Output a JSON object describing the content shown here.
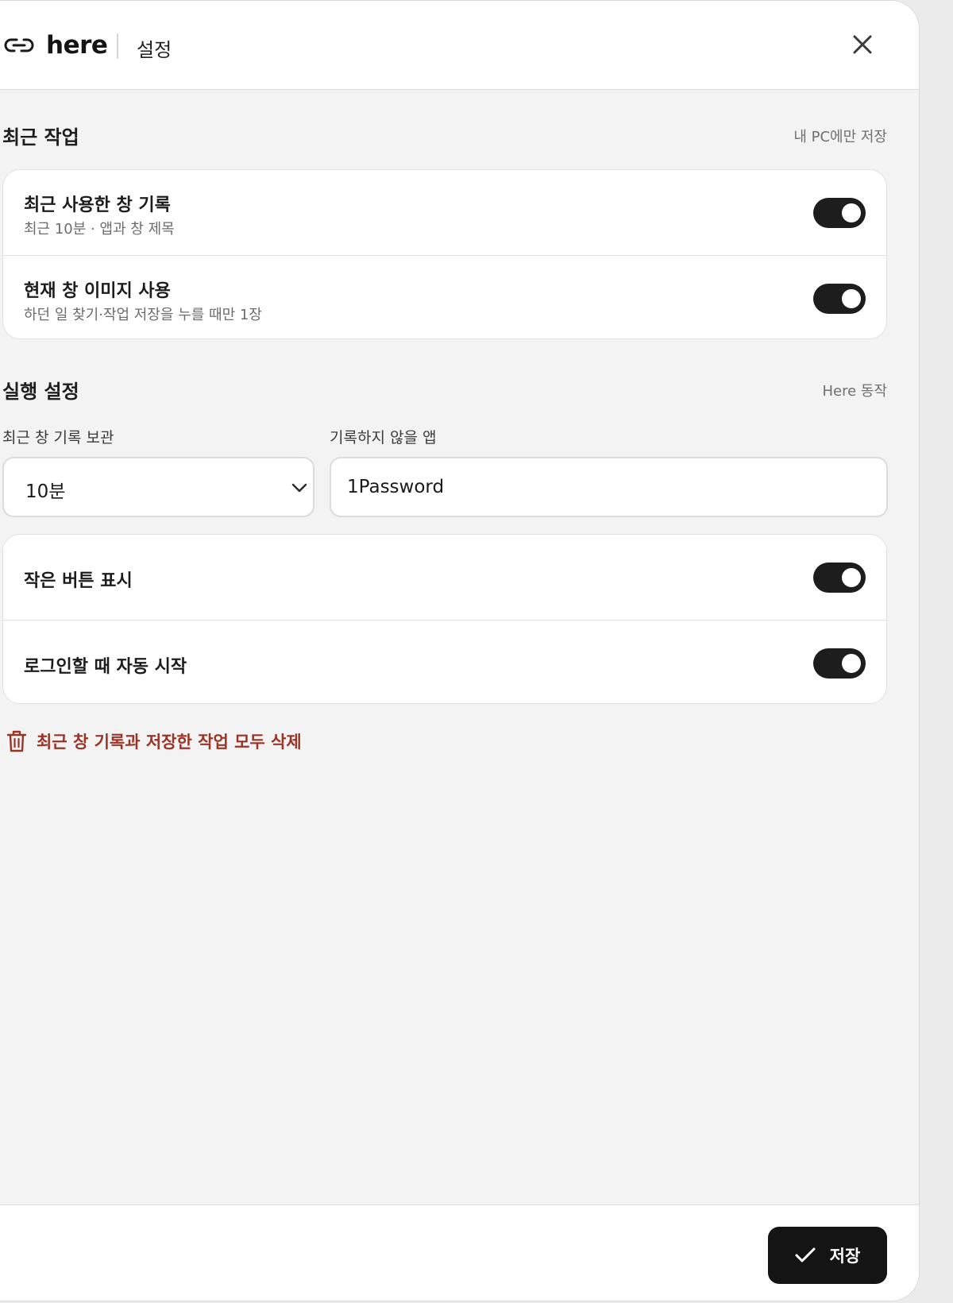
{
  "header": {
    "brand": "here",
    "title": "설정",
    "icons": {
      "logo": "link-icon",
      "close": "close-icon"
    }
  },
  "recent_work": {
    "title": "최근 작업",
    "hint": "내 PC에만 저장",
    "rows": [
      {
        "title": "최근 사용한 창 기록",
        "subtitle": "최근 10분 · 앱과 창 제목",
        "enabled": true
      },
      {
        "title": "현재 창 이미지 사용",
        "subtitle": "하던 일 찾기·작업 저장을 누를 때만 1장",
        "enabled": true
      }
    ]
  },
  "run_settings": {
    "title": "실행 설정",
    "hint": "Here 동작",
    "retention": {
      "label": "최근 창 기록 보관",
      "value": "10분"
    },
    "excluded_apps": {
      "label": "기록하지 않을 앱",
      "value": "1Password"
    },
    "rows": [
      {
        "title": "작은 버튼 표시",
        "enabled": true
      },
      {
        "title": "로그인할 때 자동 시작",
        "enabled": true
      }
    ]
  },
  "delete_all": {
    "label": "최근 창 기록과 저장한 작업 모두 삭제",
    "icon": "trash-icon",
    "color": "#9a3427"
  },
  "footer": {
    "save_label": "저장",
    "icon": "check-icon"
  },
  "colors": {
    "accent": "#141414",
    "toggle_on": "#1d1d1d",
    "danger": "#9a3427"
  }
}
